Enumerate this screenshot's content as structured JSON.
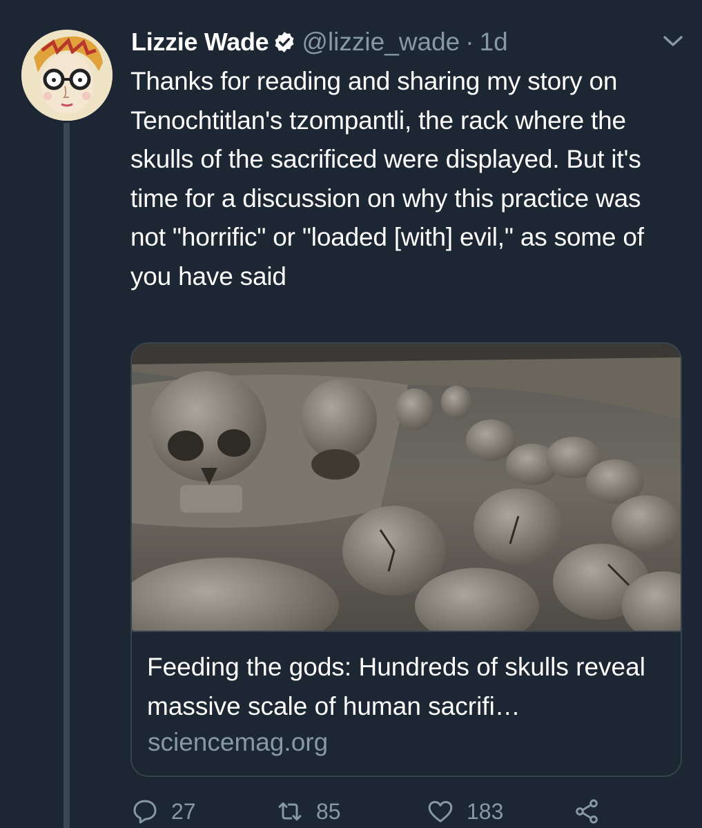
{
  "tweet": {
    "author_name": "Lizzie Wade",
    "handle": "@lizzie_wade",
    "separator": "·",
    "time": "1d",
    "text": "Thanks for reading and sharing my story on Tenochtitlan's tzompantli, the rack where the skulls of the sacrificed were displayed. But it's time for a discussion on why this practice was not \"horrific\" or \"loaded [with] evil,\" as some of you have said"
  },
  "card": {
    "title": "Feeding the gods: Hundreds of skulls reveal massive scale of human sacrifi…",
    "domain": "sciencemag.org"
  },
  "actions": {
    "reply_count": "27",
    "retweet_count": "85",
    "like_count": "183"
  },
  "icons": {
    "verified": "verified-badge-icon",
    "menu": "chevron-down-icon",
    "reply": "reply-icon",
    "retweet": "retweet-icon",
    "like": "heart-icon",
    "share": "share-icon"
  },
  "colors": {
    "background": "#1c2733",
    "secondary_text": "#8899a6",
    "border": "#38444d",
    "verified_badge": "#ffffff"
  }
}
